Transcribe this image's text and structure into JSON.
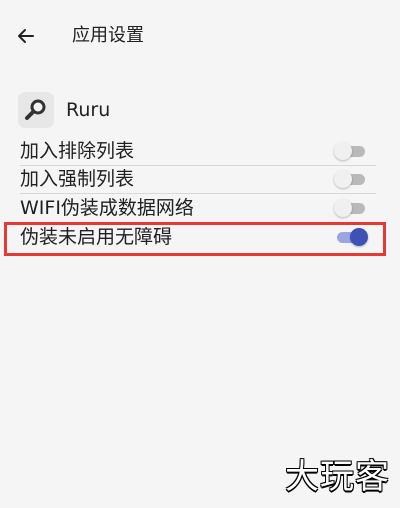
{
  "header": {
    "title": "应用设置",
    "back_icon": "arrow-left-icon"
  },
  "app": {
    "name": "Ruru",
    "icon": "search-icon"
  },
  "settings": [
    {
      "label": "加入排除列表",
      "enabled": false
    },
    {
      "label": "加入强制列表",
      "enabled": false
    },
    {
      "label": "WIFI伪装成数据网络",
      "enabled": false
    },
    {
      "label": "伪装未启用无障碍",
      "enabled": true
    }
  ],
  "colors": {
    "accent": "#3f51b5",
    "highlight": "#e53935"
  },
  "watermark": {
    "text": "大玩客"
  }
}
